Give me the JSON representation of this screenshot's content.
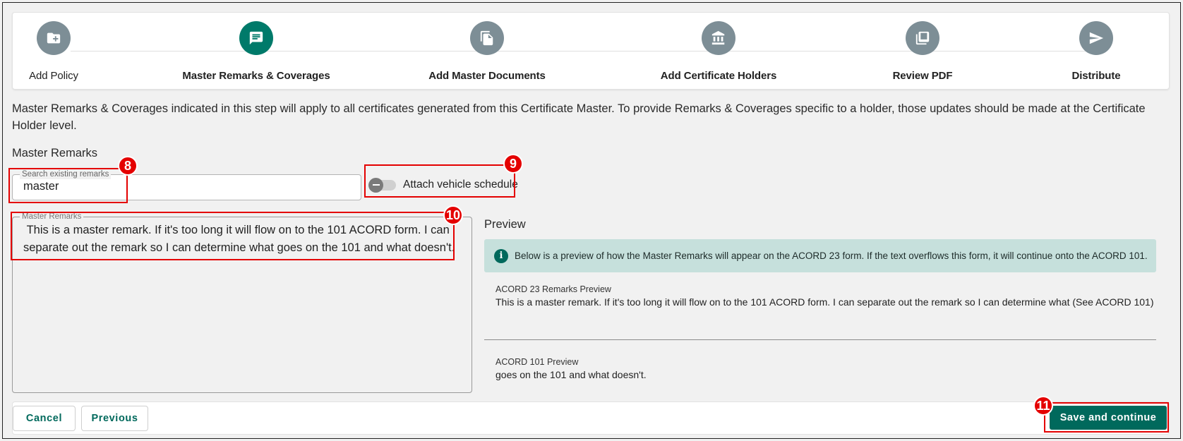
{
  "stepper": {
    "steps": [
      {
        "label": "Add Policy",
        "icon": "folder-plus-icon"
      },
      {
        "label": "Master Remarks & Coverages",
        "icon": "chat-icon",
        "active": true
      },
      {
        "label": "Add Master Documents",
        "icon": "documents-icon"
      },
      {
        "label": "Add Certificate Holders",
        "icon": "bank-icon"
      },
      {
        "label": "Review PDF",
        "icon": "pdf-icon"
      },
      {
        "label": "Distribute",
        "icon": "send-icon"
      }
    ]
  },
  "info_text": "Master Remarks & Coverages indicated in this step will apply to all certificates generated from this Certificate Master. To provide Remarks & Coverages specific to a holder, those updates should be made at the Certificate Holder level.",
  "section_title": "Master Remarks",
  "search": {
    "label": "Search existing remarks",
    "value": "master"
  },
  "toggle": {
    "label": "Attach vehicle schedule",
    "checked": false
  },
  "remarks": {
    "label": "Master Remarks",
    "value": " This is a master remark. If it's too long it will flow on to the 101 ACORD form. I can separate out the remark so I can determine what goes on the 101 and what doesn't."
  },
  "preview": {
    "title": "Preview",
    "alert": "Below is a preview of how the Master Remarks will appear on the ACORD 23 form. If the text overflows this form, it will continue onto the ACORD 101.",
    "acord23_label": "ACORD 23 Remarks Preview",
    "acord23_text": "This is a master remark. If it's too long it will flow on to the 101 ACORD form. I can separate out the remark so I can determine what (See ACORD 101)",
    "acord101_label": "ACORD 101 Preview",
    "acord101_text": "goes on the 101 and what doesn't."
  },
  "footer": {
    "cancel": "Cancel",
    "previous": "Previous",
    "save": "Save and continue"
  },
  "annotations": {
    "a8": "8",
    "a9": "9",
    "a10": "10",
    "a11": "11"
  },
  "colors": {
    "accent": "#00695c",
    "inactive_step": "#7d8e96",
    "annotation": "#e40000",
    "alert_bg": "#c6e0dc"
  }
}
